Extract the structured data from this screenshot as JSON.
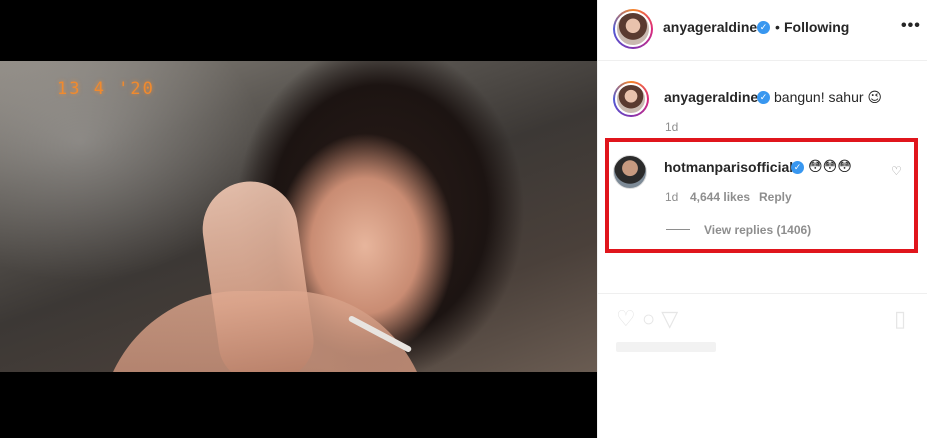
{
  "media": {
    "timestamp": "13 4 '20"
  },
  "header": {
    "username": "anyageraldine",
    "separator": "•",
    "follow_status": "Following",
    "more_icon": "more-horizontal-icon"
  },
  "caption": {
    "username": "anyageraldine",
    "text": "bangun! sahur 😉",
    "time": "1d"
  },
  "comment": {
    "username": "hotmanparisofficial",
    "text": "😳😳😳",
    "time": "1d",
    "likes": "4,644 likes",
    "reply": "Reply",
    "view_replies": "View replies (1406)"
  },
  "colors": {
    "verified": "#3897f0",
    "highlight": "#e0151c",
    "timestamp": "#f08a2e"
  }
}
